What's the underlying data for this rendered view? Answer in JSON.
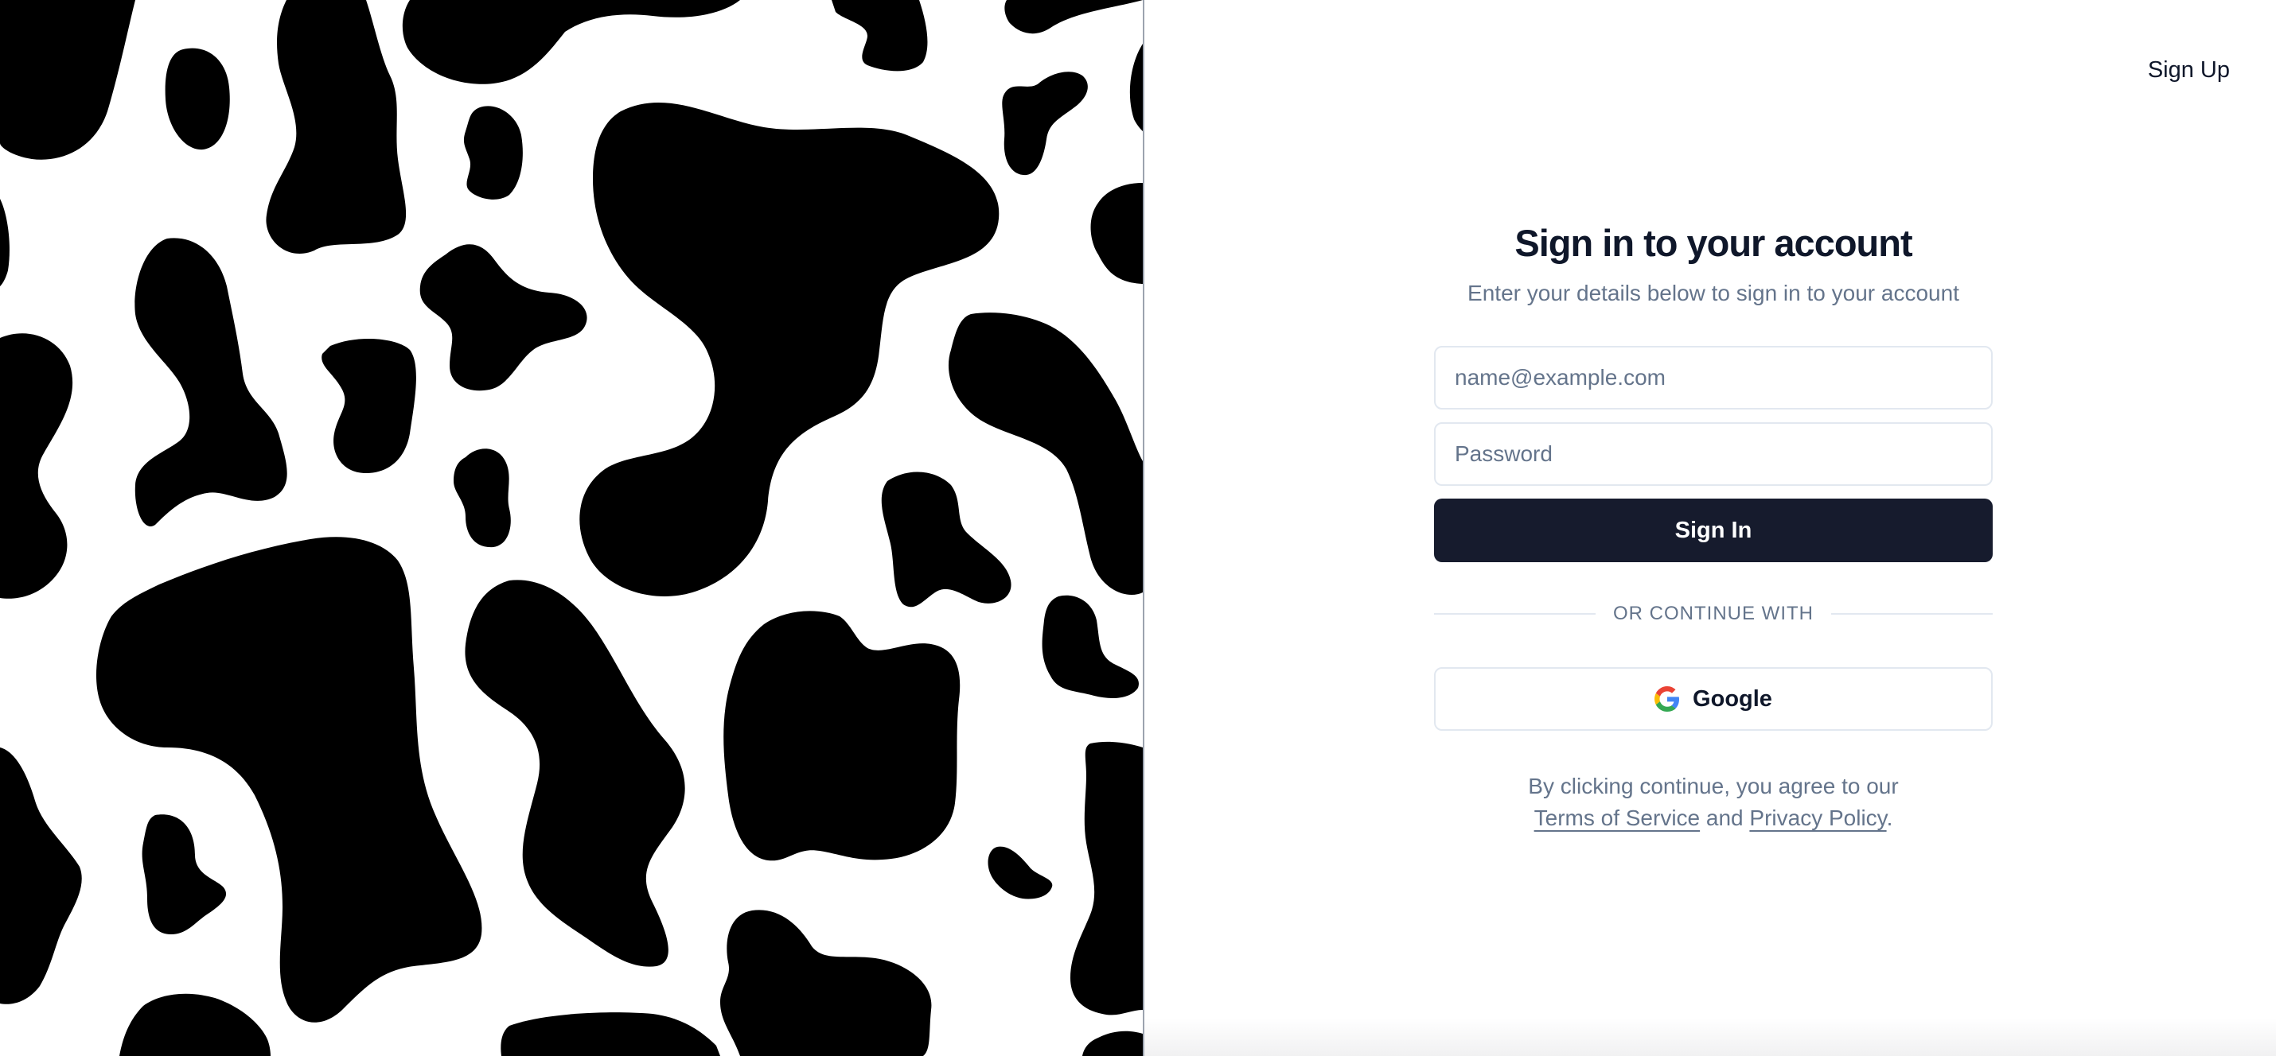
{
  "header": {
    "signup_label": "Sign Up"
  },
  "form": {
    "title": "Sign in to your account",
    "subtitle": "Enter your details below to sign in to your account",
    "email_placeholder": "name@example.com",
    "email_value": "",
    "password_placeholder": "Password",
    "password_value": "",
    "signin_label": "Sign In",
    "separator_label": "OR CONTINUE WITH",
    "google_label": "Google",
    "google_icon": "google-icon"
  },
  "legal": {
    "prefix": "By clicking continue, you agree to our",
    "terms_label": "Terms of Service",
    "conjunction": "and",
    "privacy_label": "Privacy Policy",
    "suffix": "."
  },
  "art": {
    "pattern": "cow-print",
    "spot_color": "#000000",
    "background_color": "#ffffff"
  },
  "colors": {
    "primary_button": "#161b2d",
    "muted_text": "#64748b",
    "border": "#e2e8f0"
  }
}
